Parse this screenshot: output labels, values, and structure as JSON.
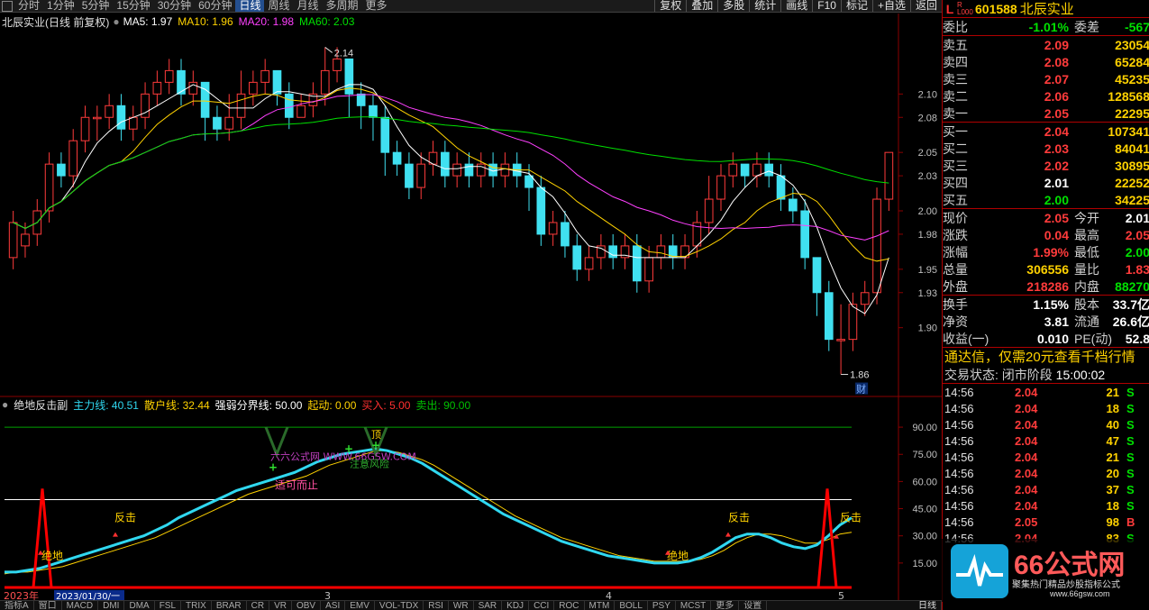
{
  "toolbar": {
    "periods": [
      "分时",
      "1分钟",
      "5分钟",
      "15分钟",
      "30分钟",
      "60分钟",
      "日线",
      "周线",
      "月线",
      "多周期",
      "更多"
    ],
    "active": "日线",
    "buttons": [
      "复权",
      "叠加",
      "多股",
      "统计",
      "画线",
      "F10",
      "标记",
      "+自选",
      "返回"
    ]
  },
  "chart_header": {
    "title": "北辰实业(日线 前复权)",
    "ma": [
      {
        "label": "MA5: 1.97",
        "color": "#ffffff"
      },
      {
        "label": "MA10: 1.96",
        "color": "#ffd200"
      },
      {
        "label": "MA20: 1.98",
        "color": "#ff40ff"
      },
      {
        "label": "MA60: 2.03",
        "color": "#00e000"
      }
    ]
  },
  "chart_data": {
    "type": "candlestick",
    "price_axis": [
      "2.10",
      "2.08",
      "2.05",
      "2.03",
      "2.00",
      "1.98",
      "1.95",
      "1.93",
      "1.90"
    ],
    "high_label": "2.14",
    "low_label": "1.86",
    "event_label": "财",
    "date_labels": [
      "2023年",
      "2023/01/30/一",
      "3",
      "4",
      "5"
    ],
    "candles": [
      [
        1.96,
        1.99,
        1.95,
        2.0
      ],
      [
        1.97,
        1.98,
        1.96,
        1.99
      ],
      [
        1.98,
        2.0,
        1.97,
        2.01
      ],
      [
        2.0,
        2.04,
        1.99,
        2.05
      ],
      [
        2.04,
        2.03,
        2.02,
        2.05
      ],
      [
        2.03,
        2.06,
        2.02,
        2.07
      ],
      [
        2.06,
        2.08,
        2.05,
        2.09
      ],
      [
        2.08,
        2.08,
        2.06,
        2.09
      ],
      [
        2.08,
        2.09,
        2.07,
        2.1
      ],
      [
        2.09,
        2.07,
        2.06,
        2.1
      ],
      [
        2.07,
        2.08,
        2.06,
        2.09
      ],
      [
        2.08,
        2.1,
        2.07,
        2.11
      ],
      [
        2.1,
        2.11,
        2.09,
        2.12
      ],
      [
        2.11,
        2.12,
        2.1,
        2.13
      ],
      [
        2.12,
        2.1,
        2.09,
        2.13
      ],
      [
        2.1,
        2.11,
        2.09,
        2.12
      ],
      [
        2.11,
        2.08,
        2.06,
        2.11
      ],
      [
        2.08,
        2.07,
        2.06,
        2.09
      ],
      [
        2.07,
        2.08,
        2.06,
        2.1
      ],
      [
        2.08,
        2.1,
        2.07,
        2.12
      ],
      [
        2.1,
        2.11,
        2.09,
        2.12
      ],
      [
        2.11,
        2.12,
        2.1,
        2.13
      ],
      [
        2.12,
        2.1,
        2.09,
        2.12
      ],
      [
        2.1,
        2.08,
        2.07,
        2.11
      ],
      [
        2.08,
        2.09,
        2.08,
        2.1
      ],
      [
        2.09,
        2.1,
        2.08,
        2.11
      ],
      [
        2.1,
        2.12,
        2.09,
        2.14
      ],
      [
        2.12,
        2.13,
        2.11,
        2.14
      ],
      [
        2.13,
        2.1,
        2.08,
        2.13
      ],
      [
        2.1,
        2.09,
        2.07,
        2.11
      ],
      [
        2.09,
        2.08,
        2.06,
        2.1
      ],
      [
        2.08,
        2.05,
        2.03,
        2.09
      ],
      [
        2.05,
        2.04,
        2.03,
        2.06
      ],
      [
        2.04,
        2.02,
        2.01,
        2.05
      ],
      [
        2.02,
        2.04,
        2.01,
        2.05
      ],
      [
        2.04,
        2.05,
        2.03,
        2.06
      ],
      [
        2.05,
        2.03,
        2.02,
        2.06
      ],
      [
        2.03,
        2.04,
        2.02,
        2.05
      ],
      [
        2.04,
        2.03,
        2.02,
        2.05
      ],
      [
        2.03,
        2.04,
        2.02,
        2.05
      ],
      [
        2.04,
        2.03,
        2.02,
        2.05
      ],
      [
        2.03,
        2.04,
        2.02,
        2.05
      ],
      [
        2.04,
        2.03,
        2.02,
        2.05
      ],
      [
        2.03,
        2.02,
        2.0,
        2.04
      ],
      [
        2.02,
        1.98,
        1.97,
        2.03
      ],
      [
        1.98,
        1.99,
        1.97,
        2.0
      ],
      [
        1.99,
        1.97,
        1.96,
        2.0
      ],
      [
        1.97,
        1.95,
        1.94,
        1.98
      ],
      [
        1.95,
        1.96,
        1.94,
        1.97
      ],
      [
        1.96,
        1.97,
        1.95,
        1.98
      ],
      [
        1.97,
        1.96,
        1.95,
        1.98
      ],
      [
        1.96,
        1.97,
        1.95,
        1.98
      ],
      [
        1.97,
        1.94,
        1.93,
        1.98
      ],
      [
        1.94,
        1.96,
        1.93,
        1.97
      ],
      [
        1.96,
        1.97,
        1.95,
        1.98
      ],
      [
        1.97,
        1.96,
        1.95,
        1.98
      ],
      [
        1.96,
        1.97,
        1.95,
        1.98
      ],
      [
        1.97,
        1.99,
        1.96,
        2.0
      ],
      [
        1.99,
        2.01,
        1.98,
        2.03
      ],
      [
        2.01,
        2.03,
        2.0,
        2.04
      ],
      [
        2.03,
        2.04,
        2.02,
        2.05
      ],
      [
        2.04,
        2.03,
        2.02,
        2.04
      ],
      [
        2.03,
        2.04,
        2.02,
        2.05
      ],
      [
        2.04,
        2.03,
        2.02,
        2.05
      ],
      [
        2.03,
        2.01,
        2.0,
        2.04
      ],
      [
        2.01,
        2.0,
        1.99,
        2.02
      ],
      [
        2.0,
        1.96,
        1.95,
        2.01
      ],
      [
        1.96,
        1.93,
        1.91,
        1.96
      ],
      [
        1.93,
        1.89,
        1.88,
        1.94
      ],
      [
        1.89,
        1.89,
        1.86,
        1.92
      ],
      [
        1.89,
        1.92,
        1.88,
        1.93
      ],
      [
        1.92,
        1.93,
        1.91,
        1.94
      ],
      [
        1.93,
        2.01,
        1.92,
        2.02
      ],
      [
        2.01,
        2.05,
        2.0,
        2.05
      ]
    ]
  },
  "indicator": {
    "title": "绝地反击副",
    "params": [
      {
        "label": "主力线: 40.51",
        "color": "#30d8f0"
      },
      {
        "label": "散户线: 32.44",
        "color": "#ffd200"
      },
      {
        "label": "强弱分界线: 50.00",
        "color": "#ffffff"
      },
      {
        "label": "起动: 0.00",
        "color": "#ffd200"
      },
      {
        "label": "买入: 5.00",
        "color": "#ff3030"
      },
      {
        "label": "卖出: 90.00",
        "color": "#00c000"
      }
    ],
    "axis": [
      "90.00",
      "75.00",
      "60.00",
      "45.00",
      "30.00",
      "15.00"
    ],
    "annotations": {
      "top": "顶",
      "watermark": "六六公式网 WWW.66GSW.COM",
      "caution": "注意风险",
      "stop": "适可而止",
      "rebound1": "反击",
      "rebound2": "反击",
      "rebound3": "反击",
      "bottom1": "绝地",
      "bottom2": "绝地"
    },
    "main_line": [
      10,
      10,
      11,
      12,
      14,
      16,
      18,
      20,
      22,
      24,
      26,
      28,
      30,
      33,
      36,
      40,
      43,
      46,
      49,
      52,
      55,
      57,
      59,
      61,
      63,
      65,
      68,
      71,
      73,
      75,
      76,
      77,
      78,
      77,
      75,
      73,
      70,
      66,
      62,
      58,
      54,
      50,
      46,
      42,
      39,
      36,
      33,
      30,
      27,
      25,
      23,
      21,
      19,
      18,
      17,
      16,
      15,
      15,
      15,
      16,
      18,
      21,
      25,
      29,
      31,
      31,
      29,
      26,
      24,
      23,
      25,
      30,
      36,
      40
    ],
    "retail_line": [
      9,
      10,
      10,
      11,
      12,
      13,
      15,
      17,
      19,
      21,
      23,
      25,
      27,
      29,
      32,
      35,
      38,
      41,
      44,
      47,
      50,
      53,
      55,
      57,
      59,
      61,
      63,
      66,
      69,
      71,
      73,
      75,
      77,
      77,
      76,
      74,
      72,
      69,
      65,
      61,
      57,
      53,
      49,
      45,
      41,
      38,
      35,
      32,
      29,
      27,
      25,
      23,
      21,
      19,
      18,
      17,
      16,
      16,
      16,
      16,
      17,
      19,
      22,
      26,
      29,
      31,
      31,
      30,
      28,
      26,
      26,
      28,
      31,
      32
    ]
  },
  "quote": {
    "code": "601588",
    "name": "北辰实业",
    "flag": "L",
    "level": "R\nL000",
    "weibi": {
      "label": "委比",
      "value": "-1.01%",
      "label2": "委差",
      "value2": "-567"
    },
    "asks": [
      {
        "label": "卖五",
        "price": "2.09",
        "vol": "23054"
      },
      {
        "label": "卖四",
        "price": "2.08",
        "vol": "65284"
      },
      {
        "label": "卖三",
        "price": "2.07",
        "vol": "45235"
      },
      {
        "label": "卖二",
        "price": "2.06",
        "vol": "128568"
      },
      {
        "label": "卖一",
        "price": "2.05",
        "vol": "22295"
      }
    ],
    "bids": [
      {
        "label": "买一",
        "price": "2.04",
        "vol": "107341",
        "color": "#ff3b3b"
      },
      {
        "label": "买二",
        "price": "2.03",
        "vol": "84041",
        "color": "#ff3b3b"
      },
      {
        "label": "买三",
        "price": "2.02",
        "vol": "30895",
        "color": "#ff3b3b"
      },
      {
        "label": "买四",
        "price": "2.01",
        "vol": "22252",
        "color": "#ffffff"
      },
      {
        "label": "买五",
        "price": "2.00",
        "vol": "34225",
        "color": "#00e000"
      }
    ],
    "stats": [
      {
        "l1": "现价",
        "v1": "2.05",
        "c1": "#ff3b3b",
        "l2": "今开",
        "v2": "2.01",
        "c2": "#ffffff"
      },
      {
        "l1": "涨跌",
        "v1": "0.04",
        "c1": "#ff3b3b",
        "l2": "最高",
        "v2": "2.05",
        "c2": "#ff3b3b"
      },
      {
        "l1": "涨幅",
        "v1": "1.99%",
        "c1": "#ff3b3b",
        "l2": "最低",
        "v2": "2.00",
        "c2": "#00e000"
      },
      {
        "l1": "总量",
        "v1": "306556",
        "c1": "#ffd200",
        "l2": "量比",
        "v2": "1.83",
        "c2": "#ff3b3b"
      },
      {
        "l1": "外盘",
        "v1": "218286",
        "c1": "#ff3b3b",
        "l2": "内盘",
        "v2": "88270",
        "c2": "#00e000"
      }
    ],
    "stats2": [
      {
        "l1": "换手",
        "v1": "1.15%",
        "l2": "股本",
        "v2": "33.7亿"
      },
      {
        "l1": "净资",
        "v1": "3.81",
        "l2": "流通",
        "v2": "26.6亿"
      },
      {
        "l1": "收益(一)",
        "v1": "0.010",
        "l2": "PE(动)",
        "v2": "52.8"
      }
    ],
    "promo": "通达信，仅需20元查看千档行情",
    "trade_state_label": "交易状态: 闭市阶段",
    "trade_state_time": "15:00:02",
    "ticks": [
      {
        "t": "14:56",
        "p": "2.04",
        "v": "21",
        "bs": "S"
      },
      {
        "t": "14:56",
        "p": "2.04",
        "v": "18",
        "bs": "S"
      },
      {
        "t": "14:56",
        "p": "2.04",
        "v": "40",
        "bs": "S"
      },
      {
        "t": "14:56",
        "p": "2.04",
        "v": "47",
        "bs": "S"
      },
      {
        "t": "14:56",
        "p": "2.04",
        "v": "21",
        "bs": "S"
      },
      {
        "t": "14:56",
        "p": "2.04",
        "v": "20",
        "bs": "S"
      },
      {
        "t": "14:56",
        "p": "2.04",
        "v": "37",
        "bs": "S"
      },
      {
        "t": "14:56",
        "p": "2.04",
        "v": "18",
        "bs": "S"
      },
      {
        "t": "14:56",
        "p": "2.05",
        "v": "98",
        "bs": "B"
      },
      {
        "t": "14:56",
        "p": "2.04",
        "v": "83",
        "bs": "S"
      }
    ]
  },
  "bottombar": {
    "items": [
      "指标A",
      "窗口",
      "MACD",
      "DMI",
      "DMA",
      "FSL",
      "TRIX",
      "BRAR",
      "CR",
      "VR",
      "OBV",
      "ASI",
      "EMV",
      "VOL-TDX",
      "RSI",
      "WR",
      "SAR",
      "KDJ",
      "CCI",
      "ROC",
      "MTM",
      "BOLL",
      "PSY",
      "MCST",
      "更多",
      "设置"
    ],
    "right": "日线"
  },
  "logo": {
    "brand": "66公式网",
    "slogan": "聚集热门精品炒股指标公式",
    "url": "www.66gsw.com"
  }
}
